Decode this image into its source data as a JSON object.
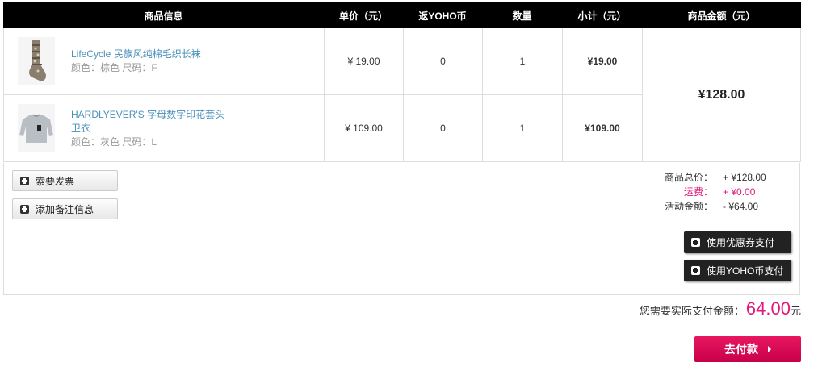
{
  "table": {
    "headers": {
      "info": "商品信息",
      "price": "单价（元）",
      "coin": "返YOHO币",
      "qty": "数量",
      "subtotal": "小计（元）",
      "total": "商品金额（元）"
    },
    "items": [
      {
        "name": "LifeCycle 民族风纯棉毛织长袜",
        "attrs": "颜色：棕色 尺码：F",
        "thumb_icon": "sock-image",
        "price": "¥ 19.00",
        "coin": "0",
        "qty": "1",
        "subtotal": "¥19.00"
      },
      {
        "name": "HARDLYEVER'S 字母数字印花套头卫衣",
        "attrs": "颜色：灰色 尺码：L",
        "thumb_icon": "sweatshirt-image",
        "price": "¥ 109.00",
        "coin": "0",
        "qty": "1",
        "subtotal": "¥109.00"
      }
    ],
    "goods_amount": "¥128.00"
  },
  "actions": {
    "invoice": "索要发票",
    "remark": "添加备注信息",
    "coupon": "使用优惠券支付",
    "yoho_coin": "使用YOHO币支付"
  },
  "fees": {
    "goods_total_label": "商品总价：",
    "goods_total_value": "+ ¥128.00",
    "shipping_label": "运费：",
    "shipping_value": "+ ¥0.00",
    "discount_label": "活动金额：",
    "discount_value": "- ¥64.00"
  },
  "pay": {
    "label": "您需要实际支付金额：",
    "amount": "64.00",
    "unit": "元",
    "button": "去付款"
  },
  "colors": {
    "accent": "#e0197d",
    "header_bg": "#000000",
    "link": "#4a90b8"
  }
}
